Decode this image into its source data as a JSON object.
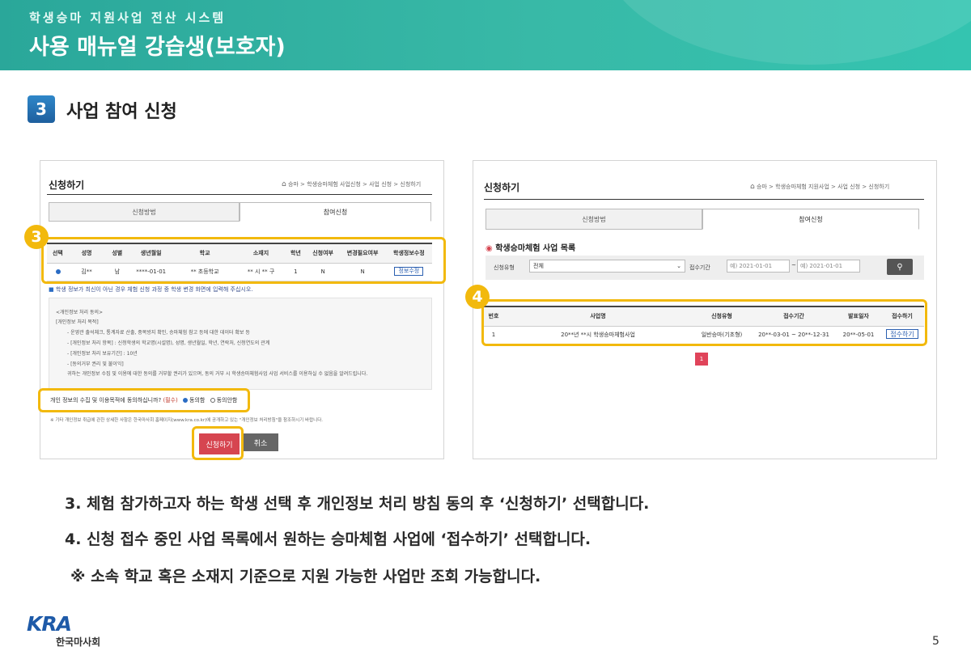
{
  "header": {
    "subtitle": "학생승마 지원사업 전산 시스템",
    "title": "사용 매뉴얼 강습생(보호자)"
  },
  "section": {
    "number": "3",
    "title": "사업 참여 신청"
  },
  "left_screen": {
    "title": "신청하기",
    "breadcrumb": "승마 > 학생승마체험 사업신청 > 사업 신청 > 신청하기",
    "tabs": [
      "신청방법",
      "참여신청"
    ],
    "columns": [
      "선택",
      "성명",
      "성별",
      "생년월일",
      "학교",
      "소재지",
      "학년",
      "신청여부",
      "변경필요여부",
      "학생정보수정"
    ],
    "row": [
      "김**",
      "남",
      "****-01-01",
      "** 초등학교",
      "** 시 ** 구",
      "1",
      "N",
      "N"
    ],
    "edit_button": "정보수정",
    "notice": "학생 정보가 최신이 아닌 경우 체험 신청 과정 중 학생 변경 화면에 입력해 주십시오.",
    "consent_lines": [
      "<개인정보 처리 동의>",
      "[개인정보 처리 목적]",
      "- 운영관 출석체크, 통계자료 산출, 중복방지 확인, 승마체험 참고 등에 대한 데이터 확보 등",
      "- [개인정보 처리 항목] : 신청학생의 학교명(시설명), 성명, 생년월일, 학년, 연락처, 신청연도의 관계",
      "- [개인정보 처리 보유기간] : 10년",
      "- [동의거부 권리 및 불이익]",
      "귀하는 개인정보 수집 및 이용에 대한 동의를 거부할 권리가 있으며, 동의 거부 시 학생승마체험사업 사업 서비스를 이용하실 수 없음을 알려드립니다."
    ],
    "agree_question": "개인 정보의 수집 및 이용목적에 동의하십니까?",
    "agree_required": "(필수)",
    "agree_yes": "동의함",
    "agree_no": "동의안함",
    "footer_note": "※ 기타 개인정보 취급에 관한 상세한 사항은 한국마사회 홈페이지(www.kra.co.kr)에 공개하고 있는 \"개인정보 처리방침\"을 참조하시기 바랍니다.",
    "apply_button": "신청하기",
    "cancel_button": "취소",
    "marker": "3"
  },
  "right_screen": {
    "title": "신청하기",
    "breadcrumb": "승마 > 학생승마체험 지원사업 > 사업 신청 > 신청하기",
    "tabs": [
      "신청방법",
      "참여신청"
    ],
    "list_title": "학생승마체험 사업 목록",
    "filter_type_label": "신청유형",
    "filter_type_value": "전체",
    "filter_period_label": "접수기간",
    "date_from": "예) 2021-01-01",
    "date_to": "예) 2021-01-01",
    "columns": [
      "번호",
      "사업명",
      "신청유형",
      "접수기간",
      "발표일자",
      "접수하기"
    ],
    "row": [
      "1",
      "20**년 **시 학생승마체험사업",
      "일반승마(기초형)",
      "20**-03-01 ~ 20**-12-31",
      "20**-05-01"
    ],
    "receive_button": "접수하기",
    "page": "1",
    "marker": "4"
  },
  "instructions": [
    "3. 체험 참가하고자 하는 학생 선택 후 개인정보 처리 방침 동의 후 ‘신청하기’ 선택합니다.",
    "4. 신청 접수 중인 사업 목록에서 원하는 승마체험 사업에 ‘접수하기’ 선택합니다.",
    "※ 소속 학교 혹은 소재지 기준으로 지원 가능한 사업만 조회 가능합니다."
  ],
  "footer": {
    "logo_text": "KRA",
    "org_name": "한국마사회",
    "page_number": "5"
  },
  "colors": {
    "header": "#2aa79a",
    "highlight": "#f2b90d",
    "apply": "#d64550"
  }
}
